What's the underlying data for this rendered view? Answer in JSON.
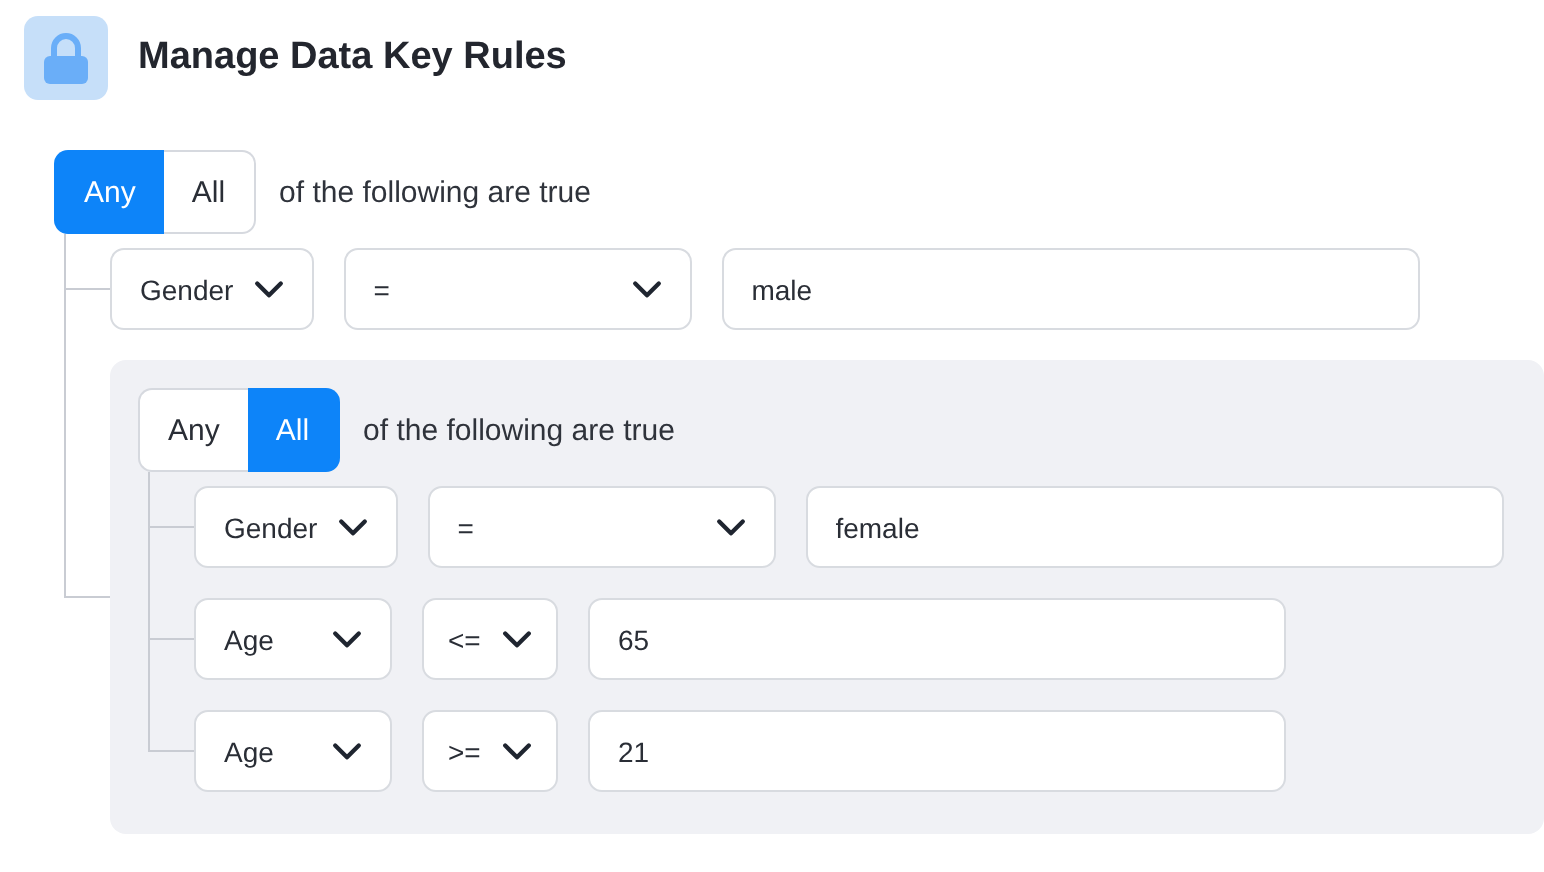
{
  "header": {
    "title": "Manage Data Key Rules"
  },
  "rule_group": {
    "match_options": [
      {
        "label": "Any",
        "selected": true
      },
      {
        "label": "All",
        "selected": false
      }
    ],
    "caption": "of the following are true",
    "children": [
      {
        "kind": "condition",
        "field": "Gender",
        "operator": "=",
        "value": "male"
      },
      {
        "kind": "group",
        "match_options": [
          {
            "label": "Any",
            "selected": false
          },
          {
            "label": "All",
            "selected": true
          }
        ],
        "caption": "of the following are true",
        "children": [
          {
            "kind": "condition",
            "field": "Gender",
            "operator": "=",
            "value": "female"
          },
          {
            "kind": "condition",
            "field": "Age",
            "operator": "<=",
            "value": "65"
          },
          {
            "kind": "condition",
            "field": "Age",
            "operator": ">=",
            "value": "21"
          }
        ]
      }
    ]
  }
}
